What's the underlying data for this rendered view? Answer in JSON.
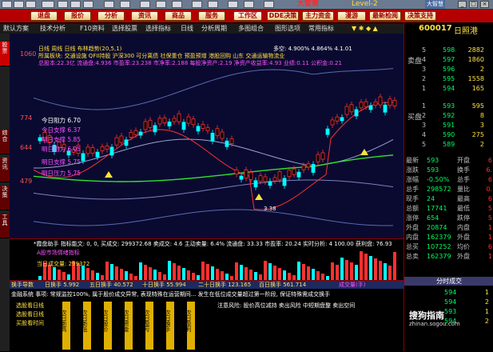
{
  "topbar": {
    "brand": "大智慧",
    "level": "Level-2",
    "brand_right": "大智慧",
    "ctrl_min": "_",
    "ctrl_max": "□",
    "ctrl_close": "×"
  },
  "menubar": {
    "items": [
      "退盘",
      "报价",
      "分析",
      "资讯",
      "商品",
      "服务",
      "工作区"
    ],
    "selected": "工作区",
    "right_items": [
      "DDE决策",
      "主力资金",
      "漫游",
      "最新检阅",
      "决策支持"
    ]
  },
  "toolbar": {
    "items": [
      "默认方案",
      "技术分析",
      "F10资料",
      "选择股票",
      "选择指标",
      "日线",
      "分析周期",
      "多图组合",
      "图形选项",
      "常用指标"
    ]
  },
  "left_tabs": [
    "股票",
    "综合",
    "资讯",
    "决策",
    "工具"
  ],
  "chart": {
    "title_line1": "日线 周线 日线  布林趋势(20,5,1)",
    "title_line2": "所属板块: 交通设施 QFII持股 沪深300 可分离债 社保重仓 预盈预增 港股回购 山东 交通运输物流业",
    "info_line": "总股本:22.3亿  流通盘:4.936  市盈率:23.238 市净率:2.188  每股净资产:2.19  净资产收益率:4.93  业绩:0.11 公积金:0.21",
    "y_ticks": [
      "1060",
      "774",
      "644",
      "479"
    ],
    "low_label": "3.38",
    "indicators": [
      {
        "label": "今日阻力 6.70",
        "color": "#ffffff"
      },
      {
        "label": "今日支撑 6.37",
        "color": "#ff50ff"
      },
      {
        "label": "明日支撑 5.85",
        "color": "#ff50ff"
      },
      {
        "label": "明日阻力 6.05",
        "color": "#ff50ff"
      },
      {
        "label": "明日支撑 5.75",
        "color": "#ff50ff"
      },
      {
        "label": "明日压力 5.75",
        "color": "#ff50ff"
      }
    ],
    "header_values": "多空: 4.900% 4.864% 4.1.01"
  },
  "volume_panel": {
    "header": "*霞盘助手 指标能文: 0, 0, 买成交: 299372.68  卖成交: 4.6  主动卖量: 6.4%  流通盘: 33.33  市盈率: 20.24  实时分析: 4 100.00  获利盘: 76.93",
    "subtitle": "A股市场情绪指标",
    "volume_label": "当日成交量: 299372"
  },
  "bottom": {
    "tabs": [
      "换手导数",
      "日换手 5.992",
      "五日换手 40.572",
      "十日换手 55.994",
      "二十日换手 123.165",
      "百日换手 561.714",
      "成交量(手)"
    ],
    "text1": "金融系统 事项: 常规监控100%, 属于股价成交异常, 表现特殊在运营期间... 发生在低位成交量超过第一阶段, 保证特殊需成交换手",
    "left_list": [
      "选股看日线",
      "选股看日线",
      "买股看时间"
    ],
    "note": "注意风险: 股价高位减持 卖出风险 中短期盘整 卖出空间",
    "cols": [
      "次日新高",
      "次日新低",
      "次日股价",
      "次日资金",
      "次日盈亏",
      "次日换手",
      "次日盈利"
    ]
  },
  "right": {
    "code": "600017",
    "name": "日照港",
    "sell_label": "卖盘",
    "buy_label": "买盘",
    "sell": [
      {
        "lvl": "5",
        "price": "598",
        "vol": "2882"
      },
      {
        "lvl": "4",
        "price": "597",
        "vol": "1860"
      },
      {
        "lvl": "3",
        "price": "596",
        "vol": "2"
      },
      {
        "lvl": "2",
        "price": "595",
        "vol": "1558"
      },
      {
        "lvl": "1",
        "price": "594",
        "vol": "165"
      }
    ],
    "buy": [
      {
        "lvl": "1",
        "price": "593",
        "vol": "595"
      },
      {
        "lvl": "2",
        "price": "592",
        "vol": "8"
      },
      {
        "lvl": "3",
        "price": "591",
        "vol": "3"
      },
      {
        "lvl": "4",
        "price": "590",
        "vol": "275"
      },
      {
        "lvl": "5",
        "price": "589",
        "vol": "2"
      }
    ],
    "stats": [
      {
        "k": "最新",
        "v": "593",
        "k2": "开盘",
        "v2": "6"
      },
      {
        "k": "涨跌",
        "v": "593",
        "k2": "换手",
        "v2": "6."
      },
      {
        "k": "涨幅",
        "v": "-0.50%",
        "k2": "总手",
        "v2": "6"
      },
      {
        "k": "总手",
        "v": "298572",
        "k2": "量比",
        "v2": "0."
      },
      {
        "k": "现手",
        "v": "24",
        "k2": "最高",
        "v2": "6"
      },
      {
        "k": "总额",
        "v": "17741",
        "k2": "最低",
        "v2": "5"
      },
      {
        "k": "涨停",
        "v": "654",
        "k2": "跌停",
        "v2": "5"
      },
      {
        "k": "外盘",
        "v": "20874",
        "k2": "内盘",
        "v2": "1"
      },
      {
        "k": "内盘",
        "v": "162379",
        "k2": "外盘",
        "v2": "1"
      },
      {
        "k": "总买",
        "v": "107252",
        "k2": "均价",
        "v2": "6"
      },
      {
        "k": "总卖",
        "v": "162379",
        "k2": "外盘",
        "v2": "1"
      }
    ],
    "trade_header": "分时成交",
    "trades": [
      {
        "price": "594",
        "vol": "1"
      },
      {
        "price": "594",
        "vol": "2"
      },
      {
        "price": "593",
        "vol": "1"
      },
      {
        "price": "594",
        "vol": "2"
      }
    ],
    "watermark": "搜狗指南",
    "watermark_url": "zhinan.sogou.com"
  },
  "colors": {
    "menu_red": "#b40000",
    "up": "#ff3030",
    "down": "#00ffff",
    "yellow": "#ffe040",
    "green": "#30e030"
  }
}
